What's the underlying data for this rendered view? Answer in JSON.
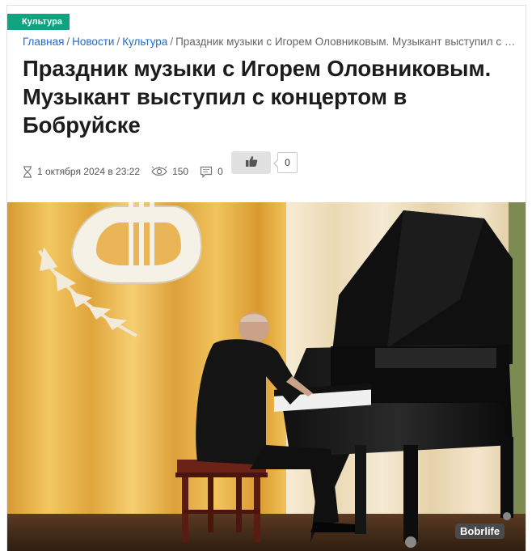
{
  "category_badge": "Культура",
  "breadcrumb": {
    "items": [
      "Главная",
      "Новости",
      "Культура"
    ],
    "current": "Праздник музыки с Игорем Оловниковым. Музыкант выступил с концертом в Бобруйске",
    "separator": "/"
  },
  "article": {
    "title": "Праздник музыки с Игорем Оловниковым. Музыкант выступил с концертом в Бобруйске",
    "date": "1 октября 2024 в 23:22",
    "views": "150",
    "comments": "0",
    "likes": "0"
  },
  "photo": {
    "watermark": "Bobrlife"
  },
  "icons": {
    "date": "hourglass-icon",
    "views": "eye-icon",
    "comments": "comment-icon",
    "like": "thumbs-up-icon"
  },
  "colors": {
    "badge": "#0fa37f",
    "link": "#1e6bd6",
    "title": "#1c1c1c",
    "like_button": "#e1e1e1"
  }
}
